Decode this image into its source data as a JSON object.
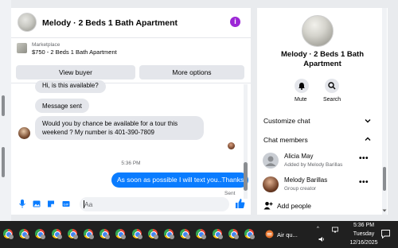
{
  "chat": {
    "title": "Melody · 2 Beds 1 Bath Apartment",
    "listing": {
      "source": "Marketplace",
      "price_title": "$750 - 2 Beds 1 Bath Apartment",
      "view_buyer": "View buyer",
      "more_options": "More options"
    },
    "messages": {
      "m1": "Hi, is this available?",
      "m2": "Message sent",
      "m3_line1": "Would you by chance be available for a tour this",
      "m3_line2": "weekend ? My number is 401-390-7809",
      "time": "5:36 PM",
      "outgoing": "As soon as possible I will text you..Thanks",
      "status": "Sent"
    },
    "composer": {
      "placeholder": "Aa"
    }
  },
  "panel": {
    "title_line1": "Melody · 2 Beds 1 Bath",
    "title_line2": "Apartment",
    "mute_label": "Mute",
    "search_label": "Search",
    "customize_label": "Customize chat",
    "members_label": "Chat members",
    "members": [
      {
        "name": "Alicia May",
        "sub": "Added by Melody Barillas"
      },
      {
        "name": "Melody Barillas",
        "sub": "Group creator"
      }
    ],
    "more_glyph": "•••",
    "add_people_label": "Add people"
  },
  "taskbar": {
    "weather": "Air qu...",
    "time": "5:36 PM",
    "day": "Tuesday",
    "date": "12/16/2025"
  },
  "colors": {
    "accent": "#0a7cff",
    "info": "#9c27d6",
    "bubble_in": "#e4e6eb"
  }
}
